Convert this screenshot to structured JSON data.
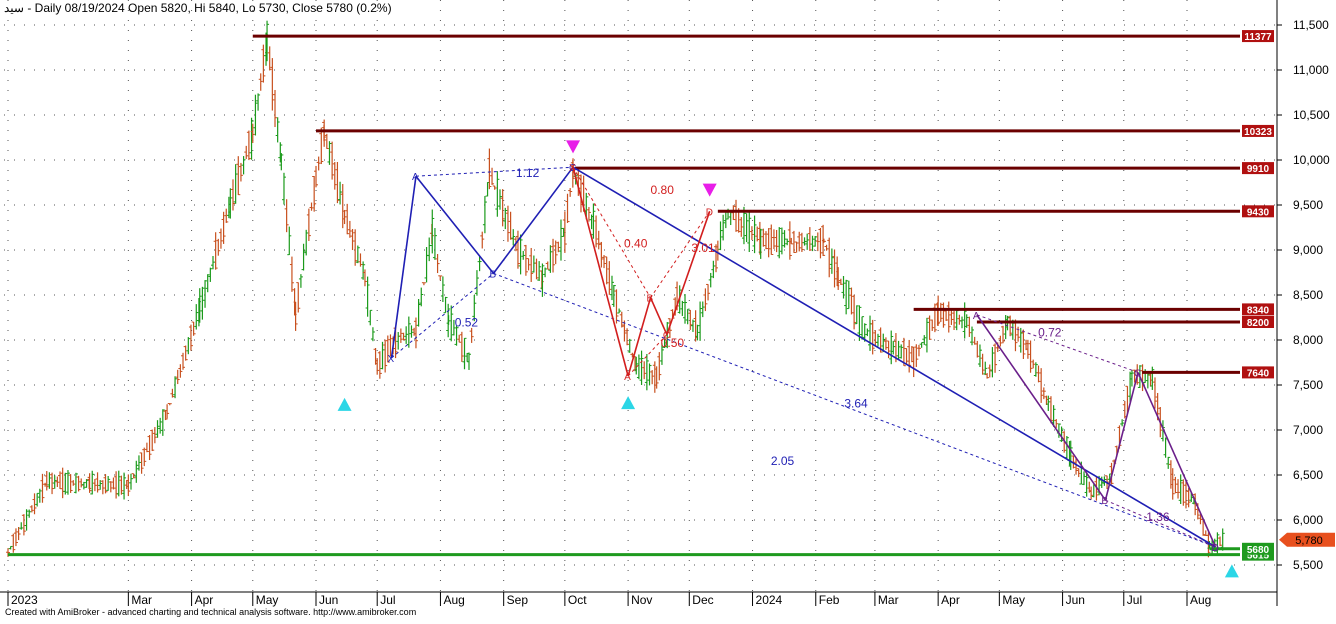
{
  "header": {
    "symbol": "سيد",
    "info": "- Daily 08/19/2024 Open 5820, Hi 5840, Lo 5730, Close 5780 (0.2%)"
  },
  "footer": "Created with AmiBroker - advanced charting and technical analysis software. http://www.amibroker.com",
  "chart_data": {
    "type": "candlestick",
    "title": "",
    "xlabel": "",
    "ylabel": "",
    "x_range": [
      "2023-01-01",
      "2024-08-26"
    ],
    "y_range": [
      5250,
      11900
    ],
    "y_ticks": [
      5500,
      6000,
      6500,
      7000,
      7500,
      8000,
      8500,
      9000,
      9500,
      10000,
      10500,
      11000,
      11500
    ],
    "y_tick_labels": [
      "5,500",
      "6,000",
      "6,500",
      "7,000",
      "7,500",
      "8,000",
      "8,500",
      "9,000",
      "9,500",
      "10,000",
      "10,500",
      "11,000",
      "11,500"
    ],
    "x_ticks": [
      {
        "date": "2023-01-01",
        "label": "2023"
      },
      {
        "date": "2023-03-01",
        "label": "Mar"
      },
      {
        "date": "2023-04-01",
        "label": "Apr"
      },
      {
        "date": "2023-05-01",
        "label": "May"
      },
      {
        "date": "2023-06-01",
        "label": "Jun"
      },
      {
        "date": "2023-07-01",
        "label": "Jul"
      },
      {
        "date": "2023-08-01",
        "label": "Aug"
      },
      {
        "date": "2023-09-01",
        "label": "Sep"
      },
      {
        "date": "2023-10-01",
        "label": "Oct"
      },
      {
        "date": "2023-11-01",
        "label": "Nov"
      },
      {
        "date": "2023-12-01",
        "label": "Dec"
      },
      {
        "date": "2024-01-01",
        "label": "2024"
      },
      {
        "date": "2024-02-01",
        "label": "Feb"
      },
      {
        "date": "2024-03-01",
        "label": "Mar"
      },
      {
        "date": "2024-04-01",
        "label": "Apr"
      },
      {
        "date": "2024-05-01",
        "label": "May"
      },
      {
        "date": "2024-06-01",
        "label": "Jun"
      },
      {
        "date": "2024-07-01",
        "label": "Jul"
      },
      {
        "date": "2024-08-01",
        "label": "Aug"
      }
    ],
    "grid": true,
    "colors": {
      "up": "#1a9a1a",
      "down": "#c8501e",
      "resistance": "#6b0000",
      "support": "#1e9a1e",
      "pattern_blue": "#1f1fb4",
      "pattern_red": "#d21e1e",
      "pattern_purple": "#6a1f8a",
      "label_bg": "#b01010",
      "last_price_bg": "#e8501e"
    },
    "price_path": [
      [
        "2023-01-01",
        5640
      ],
      [
        "2023-01-20",
        6430
      ],
      [
        "2023-02-10",
        6400
      ],
      [
        "2023-03-01",
        6380
      ],
      [
        "2023-03-20",
        7200
      ],
      [
        "2023-04-05",
        8350
      ],
      [
        "2023-04-20",
        9500
      ],
      [
        "2023-05-01",
        10300
      ],
      [
        "2023-05-08",
        11350
      ],
      [
        "2023-05-15",
        10000
      ],
      [
        "2023-05-22",
        8300
      ],
      [
        "2023-06-01",
        9800
      ],
      [
        "2023-06-05",
        10320
      ],
      [
        "2023-06-15",
        9400
      ],
      [
        "2023-06-25",
        8700
      ],
      [
        "2023-07-01",
        7700
      ],
      [
        "2023-07-10",
        8000
      ],
      [
        "2023-07-20",
        8100
      ],
      [
        "2023-07-28",
        9200
      ],
      [
        "2023-08-05",
        8200
      ],
      [
        "2023-08-15",
        7800
      ],
      [
        "2023-08-25",
        9860
      ],
      [
        "2023-09-08",
        9000
      ],
      [
        "2023-09-20",
        8700
      ],
      [
        "2023-10-01",
        9200
      ],
      [
        "2023-10-05",
        9900
      ],
      [
        "2023-10-15",
        9300
      ],
      [
        "2023-10-25",
        8500
      ],
      [
        "2023-11-05",
        7700
      ],
      [
        "2023-11-15",
        7600
      ],
      [
        "2023-11-25",
        8480
      ],
      [
        "2023-12-05",
        8100
      ],
      [
        "2023-12-15",
        9000
      ],
      [
        "2023-12-20",
        9430
      ],
      [
        "2024-01-05",
        9100
      ],
      [
        "2024-01-20",
        9080
      ],
      [
        "2024-02-05",
        9100
      ],
      [
        "2024-02-12",
        8700
      ],
      [
        "2024-02-25",
        8100
      ],
      [
        "2024-03-10",
        7900
      ],
      [
        "2024-03-20",
        7800
      ],
      [
        "2024-04-01",
        8300
      ],
      [
        "2024-04-15",
        8200
      ],
      [
        "2024-04-25",
        7600
      ],
      [
        "2024-05-05",
        8200
      ],
      [
        "2024-05-15",
        7900
      ],
      [
        "2024-05-25",
        7300
      ],
      [
        "2024-06-05",
        6700
      ],
      [
        "2024-06-15",
        6300
      ],
      [
        "2024-06-25",
        6500
      ],
      [
        "2024-07-05",
        7600
      ],
      [
        "2024-07-15",
        7580
      ],
      [
        "2024-07-25",
        6400
      ],
      [
        "2024-08-05",
        6200
      ],
      [
        "2024-08-12",
        5700
      ],
      [
        "2024-08-19",
        5780
      ]
    ],
    "horizontal_levels": [
      {
        "value": 11377,
        "label": "11377",
        "start": "2023-05-01"
      },
      {
        "value": 10323,
        "label": "10323",
        "start": "2023-06-01"
      },
      {
        "value": 9910,
        "label": "9910",
        "start": "2023-10-06"
      },
      {
        "value": 9430,
        "label": "9430",
        "start": "2023-12-15"
      },
      {
        "value": 8340,
        "label": "8340",
        "start": "2024-03-20"
      },
      {
        "value": 8200,
        "label": "8200",
        "start": "2024-04-20"
      },
      {
        "value": 7640,
        "label": "7640",
        "start": "2024-07-10"
      },
      {
        "value": 5615,
        "label": "5615",
        "start": "2023-01-01",
        "color": "support"
      },
      {
        "value": 5680,
        "label": "5680",
        "start": "2024-08-12",
        "color": "support"
      }
    ],
    "last_price": {
      "value": 5780,
      "label": "5,780"
    },
    "harmonic_patterns": [
      {
        "color": "pattern_blue",
        "points": {
          "X": [
            "2023-07-08",
            7800
          ],
          "A": [
            "2023-07-20",
            9820
          ],
          "B": [
            "2023-08-27",
            8740
          ],
          "C": [
            "2023-10-05",
            9920
          ],
          "D": [
            "2024-08-15",
            5700
          ]
        }
      },
      {
        "color": "pattern_red",
        "points": {
          "X": [
            "2023-10-05",
            9920
          ],
          "A": [
            "2023-11-01",
            7600
          ],
          "B": [
            "2023-11-12",
            8470
          ],
          "C": [
            "2023-11-20",
            8060
          ],
          "D": [
            "2023-12-11",
            9430
          ]
        }
      },
      {
        "color": "pattern_purple",
        "points": {
          "A": [
            "2024-04-20",
            8280
          ],
          "B": [
            "2024-06-22",
            6220
          ],
          "C": [
            "2024-07-08",
            7640
          ],
          "D": [
            "2024-08-15",
            5700
          ]
        }
      }
    ],
    "ratio_labels": [
      {
        "text": "1.12",
        "x": "2023-09-07",
        "y": 9810,
        "color": "pattern_blue"
      },
      {
        "text": "0.52",
        "x": "2023-08-08",
        "y": 8150,
        "color": "pattern_blue"
      },
      {
        "text": "3.64",
        "x": "2024-02-15",
        "y": 7250,
        "color": "pattern_blue"
      },
      {
        "text": "2.05",
        "x": "2024-01-10",
        "y": 6610,
        "color": "pattern_blue"
      },
      {
        "text": "0.80",
        "x": "2023-11-12",
        "y": 9620,
        "color": "pattern_red"
      },
      {
        "text": "0.40",
        "x": "2023-10-30",
        "y": 9030,
        "color": "pattern_red"
      },
      {
        "text": "3.01",
        "x": "2023-12-02",
        "y": 8980,
        "color": "pattern_red"
      },
      {
        "text": "0.50",
        "x": "2023-11-17",
        "y": 7920,
        "color": "pattern_red"
      },
      {
        "text": "0.72",
        "x": "2024-05-20",
        "y": 8040,
        "color": "pattern_purple"
      },
      {
        "text": "1.36",
        "x": "2024-07-12",
        "y": 5990,
        "color": "pattern_purple"
      }
    ],
    "markers": [
      {
        "type": "triangle-down",
        "x": "2023-10-05",
        "y": 10140,
        "color": "#e81ee8"
      },
      {
        "type": "triangle-down",
        "x": "2023-12-11",
        "y": 9660,
        "color": "#e81ee8"
      },
      {
        "type": "triangle-up",
        "x": "2023-06-15",
        "y": 7290,
        "color": "#2bd6e6"
      },
      {
        "type": "triangle-up",
        "x": "2023-11-01",
        "y": 7310,
        "color": "#2bd6e6"
      },
      {
        "type": "triangle-up",
        "x": "2024-08-23",
        "y": 5440,
        "color": "#2bd6e6"
      }
    ]
  }
}
